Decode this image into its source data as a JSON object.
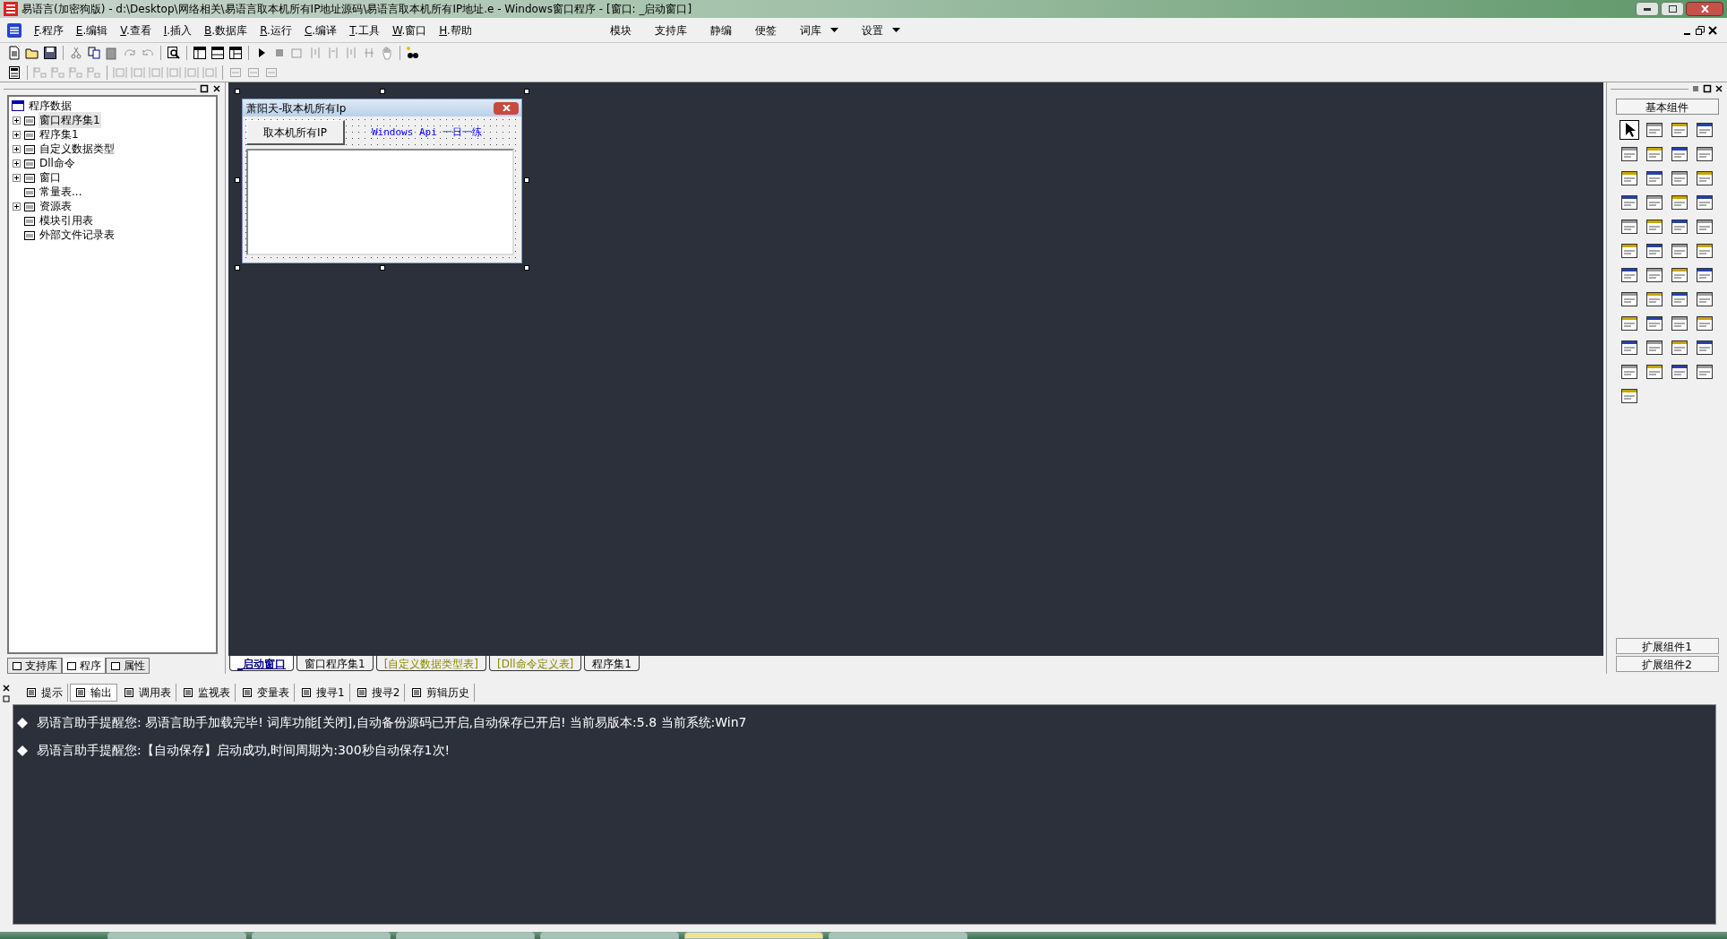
{
  "title_bar": {
    "title": "易语言(加密狗版) - d:\\Desktop\\网络相关\\易语言取本机所有IP地址源码\\易语言取本机所有IP地址.e - Windows窗口程序 - [窗口: _启动窗口]"
  },
  "menu": [
    {
      "key": "F",
      "label": ".程序"
    },
    {
      "key": "E",
      "label": ".编辑"
    },
    {
      "key": "V",
      "label": ".查看"
    },
    {
      "key": "I",
      "label": ".插入"
    },
    {
      "key": "B",
      "label": ".数据库"
    },
    {
      "key": "R",
      "label": ".运行"
    },
    {
      "key": "C",
      "label": ".编译"
    },
    {
      "key": "T",
      "label": ".工具"
    },
    {
      "key": "W",
      "label": ".窗口"
    },
    {
      "key": "H",
      "label": ".帮助"
    }
  ],
  "menu_right": [
    {
      "label": "模块",
      "dropdown": false
    },
    {
      "label": "支持库",
      "dropdown": false
    },
    {
      "label": "静编",
      "dropdown": false
    },
    {
      "label": "便签",
      "dropdown": false
    },
    {
      "label": "词库",
      "dropdown": true
    },
    {
      "label": "设置",
      "dropdown": true
    }
  ],
  "tree": {
    "label": "程序数据",
    "children": [
      {
        "label": "窗口程序集1",
        "expandable": true,
        "selected": true
      },
      {
        "label": "程序集1",
        "expandable": true,
        "selected": false
      },
      {
        "label": "自定义数据类型",
        "expandable": true,
        "selected": false
      },
      {
        "label": "Dll命令",
        "expandable": true,
        "selected": false
      },
      {
        "label": "窗口",
        "expandable": true,
        "selected": false
      },
      {
        "label": "常量表...",
        "expandable": false,
        "selected": false
      },
      {
        "label": "资源表",
        "expandable": true,
        "selected": false
      },
      {
        "label": "模块引用表",
        "expandable": false,
        "selected": false
      },
      {
        "label": "外部文件记录表",
        "expandable": false,
        "selected": false
      }
    ]
  },
  "left_tabs": [
    {
      "label": "支持库",
      "selected": false
    },
    {
      "label": "程序",
      "selected": true
    },
    {
      "label": "属性",
      "selected": false
    }
  ],
  "form": {
    "title": "萧阳天-取本机所有Ip",
    "button": "取本机所有IP",
    "label": "Windows Api 一日一练"
  },
  "editor_tabs": [
    {
      "label": "_启动窗口",
      "kind": "window",
      "selected": true
    },
    {
      "label": "窗口程序集1",
      "kind": "code",
      "selected": false
    },
    {
      "label": "[自定义数据类型表]",
      "kind": "table",
      "selected": false
    },
    {
      "label": "[Dll命令定义表]",
      "kind": "table",
      "selected": false
    },
    {
      "label": "程序集1",
      "kind": "code",
      "selected": false
    }
  ],
  "toolbox": {
    "title": "基本组件",
    "extra": [
      "扩展组件1",
      "扩展组件2"
    ]
  },
  "bottom_tabs": [
    {
      "label": "提示",
      "selected": false
    },
    {
      "label": "输出",
      "selected": true
    },
    {
      "label": "调用表",
      "selected": false
    },
    {
      "label": "监视表",
      "selected": false
    },
    {
      "label": "变量表",
      "selected": false
    },
    {
      "label": "搜寻1",
      "selected": false
    },
    {
      "label": "搜寻2",
      "selected": false
    },
    {
      "label": "剪辑历史",
      "selected": false
    }
  ],
  "output": [
    "易语言助手提醒您:  易语言助手加载完毕!  词库功能[关闭],自动备份源码已开启,自动保存已开启!  当前易版本:5.8  当前系统:Win7",
    "易语言助手提醒您:【自动保存】启动成功,时间周期为:300秒自动保存1次!"
  ]
}
